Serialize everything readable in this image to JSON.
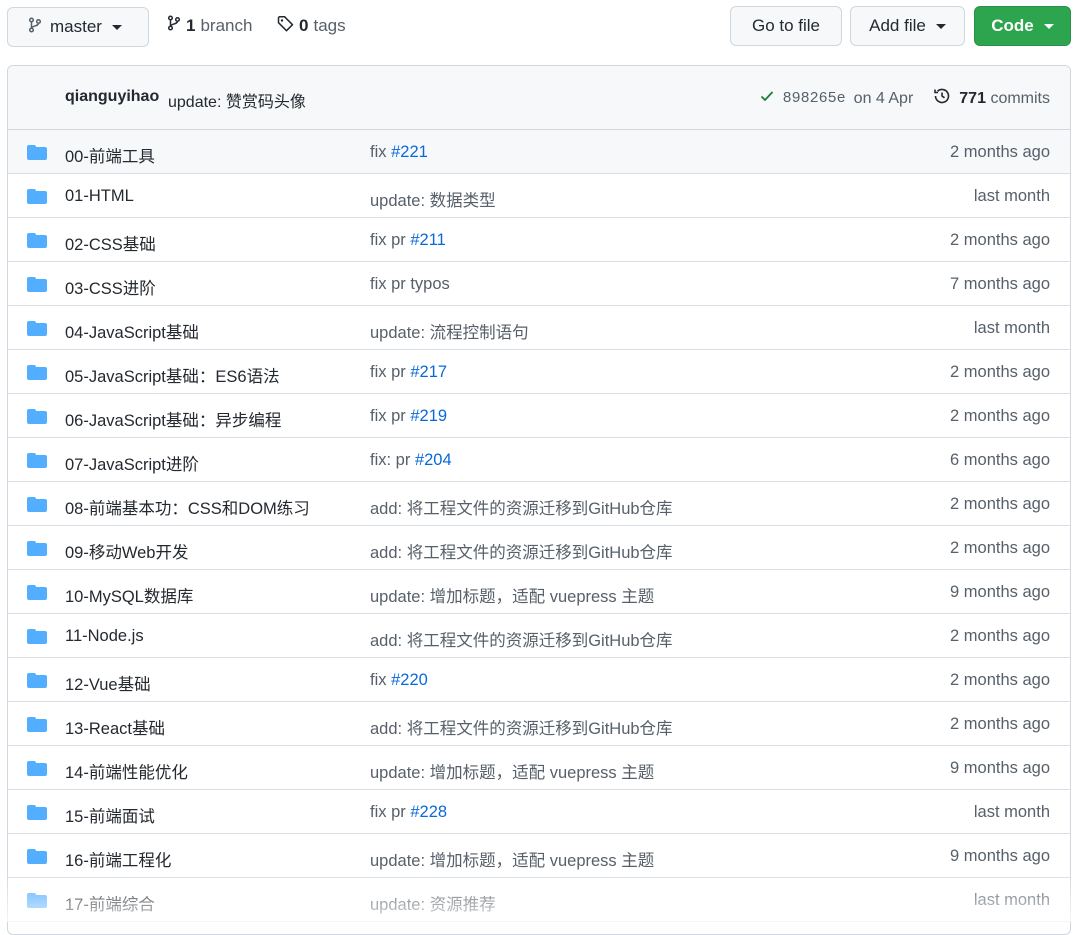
{
  "toolbar": {
    "branch_button_label": "master",
    "branches_count": "1",
    "branches_label": "branch",
    "tags_count": "0",
    "tags_label": "tags",
    "go_to_file_label": "Go to file",
    "add_file_label": "Add file",
    "code_label": "Code"
  },
  "latest_commit": {
    "author": "qianguyihao",
    "message": "update: 赞赏码头像",
    "sha": "898265e",
    "date": "on 4 Apr",
    "commits_count": "771",
    "commits_label": "commits"
  },
  "colors": {
    "code_button": "#2da44e",
    "folder_icon": "#54aeff",
    "link": "#0969da",
    "check": "#1a7f37"
  },
  "files": [
    {
      "name": "00-前端工具",
      "msg_text": "fix ",
      "msg_link": "#221",
      "age": "2 months ago"
    },
    {
      "name": "01-HTML",
      "msg_text": "update: 数据类型",
      "msg_link": "",
      "age": "last month"
    },
    {
      "name": "02-CSS基础",
      "msg_text": "fix pr ",
      "msg_link": "#211",
      "age": "2 months ago"
    },
    {
      "name": "03-CSS进阶",
      "msg_text": "fix pr typos",
      "msg_link": "",
      "age": "7 months ago"
    },
    {
      "name": "04-JavaScript基础",
      "msg_text": "update: 流程控制语句",
      "msg_link": "",
      "age": "last month"
    },
    {
      "name": "05-JavaScript基础：ES6语法",
      "msg_text": "fix pr ",
      "msg_link": "#217",
      "age": "2 months ago"
    },
    {
      "name": "06-JavaScript基础：异步编程",
      "msg_text": "fix pr ",
      "msg_link": "#219",
      "age": "2 months ago"
    },
    {
      "name": "07-JavaScript进阶",
      "msg_text": "fix: pr ",
      "msg_link": "#204",
      "age": "6 months ago"
    },
    {
      "name": "08-前端基本功：CSS和DOM练习",
      "msg_text": "add: 将工程文件的资源迁移到GitHub仓库",
      "msg_link": "",
      "age": "2 months ago"
    },
    {
      "name": "09-移动Web开发",
      "msg_text": "add: 将工程文件的资源迁移到GitHub仓库",
      "msg_link": "",
      "age": "2 months ago"
    },
    {
      "name": "10-MySQL数据库",
      "msg_text": "update: 增加标题，适配 vuepress 主题",
      "msg_link": "",
      "age": "9 months ago"
    },
    {
      "name": "11-Node.js",
      "msg_text": "add: 将工程文件的资源迁移到GitHub仓库",
      "msg_link": "",
      "age": "2 months ago"
    },
    {
      "name": "12-Vue基础",
      "msg_text": "fix ",
      "msg_link": "#220",
      "age": "2 months ago"
    },
    {
      "name": "13-React基础",
      "msg_text": "add: 将工程文件的资源迁移到GitHub仓库",
      "msg_link": "",
      "age": "2 months ago"
    },
    {
      "name": "14-前端性能优化",
      "msg_text": "update: 增加标题，适配 vuepress 主题",
      "msg_link": "",
      "age": "9 months ago"
    },
    {
      "name": "15-前端面试",
      "msg_text": "fix pr ",
      "msg_link": "#228",
      "age": "last month"
    },
    {
      "name": "16-前端工程化",
      "msg_text": "update: 增加标题，适配 vuepress 主题",
      "msg_link": "",
      "age": "9 months ago"
    },
    {
      "name": "17-前端综合",
      "msg_text": "update: 资源推荐",
      "msg_link": "",
      "age": "last month"
    }
  ]
}
